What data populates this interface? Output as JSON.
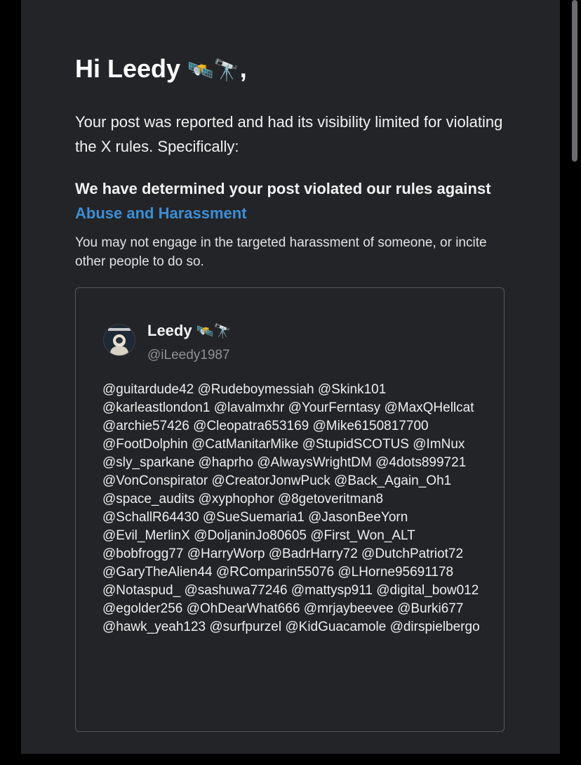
{
  "email": {
    "greeting_name": "Hi Leedy",
    "greeting_emoji": "🛰️🔭",
    "greeting_punct": ",",
    "intro": "Your post was reported and had its visibility limited for violating the X rules. Specifically:",
    "rule_prefix": "We have determined your post violated our rules against",
    "rule_link": "Abuse and Harassment",
    "rule_description": "You may not engage in the targeted harassment of someone, or incite other people to do so."
  },
  "post": {
    "author_name": "Leedy",
    "author_emoji": "🛰️🔭",
    "author_handle": "@iLeedy1987",
    "body": "@guitardude42 @Rudeboymessiah @Skink101 @karleastlondon1 @lavalmxhr @YourFerntasy @MaxQHellcat @archie57426 @Cleopatra653169 @Mike6150817700 @FootDolphin @CatManitarMike @StupidSCOTUS @ImNux @sly_sparkane @haprho @AlwaysWrightDM @4dots899721 @VonConspirator @CreatorJonwPuck @Back_Again_Oh1 @space_audits @xyphophor @8getoveritman8 @SchallR64430 @SueSuemaria1 @JasonBeeYorn @Evil_MerlinX @DoljaninJo80605 @First_Won_ALT @bobfrogg77 @HarryWorp @BadrHarry72 @DutchPatriot72 @GaryTheAlien44 @RComparin55076 @LHorne95691178 @Notaspud_ @sashuwa77246 @mattysp911 @digital_bow012 @egolder256 @OhDearWhat666 @mrjaybeevee @Burki677 @hawk_yeah123 @surfpurzel @KidGuacamole @dirspielbergo"
  },
  "colors": {
    "background": "#000000",
    "card": "#232427",
    "link": "#3b8fd6",
    "handle": "#8f9196"
  }
}
